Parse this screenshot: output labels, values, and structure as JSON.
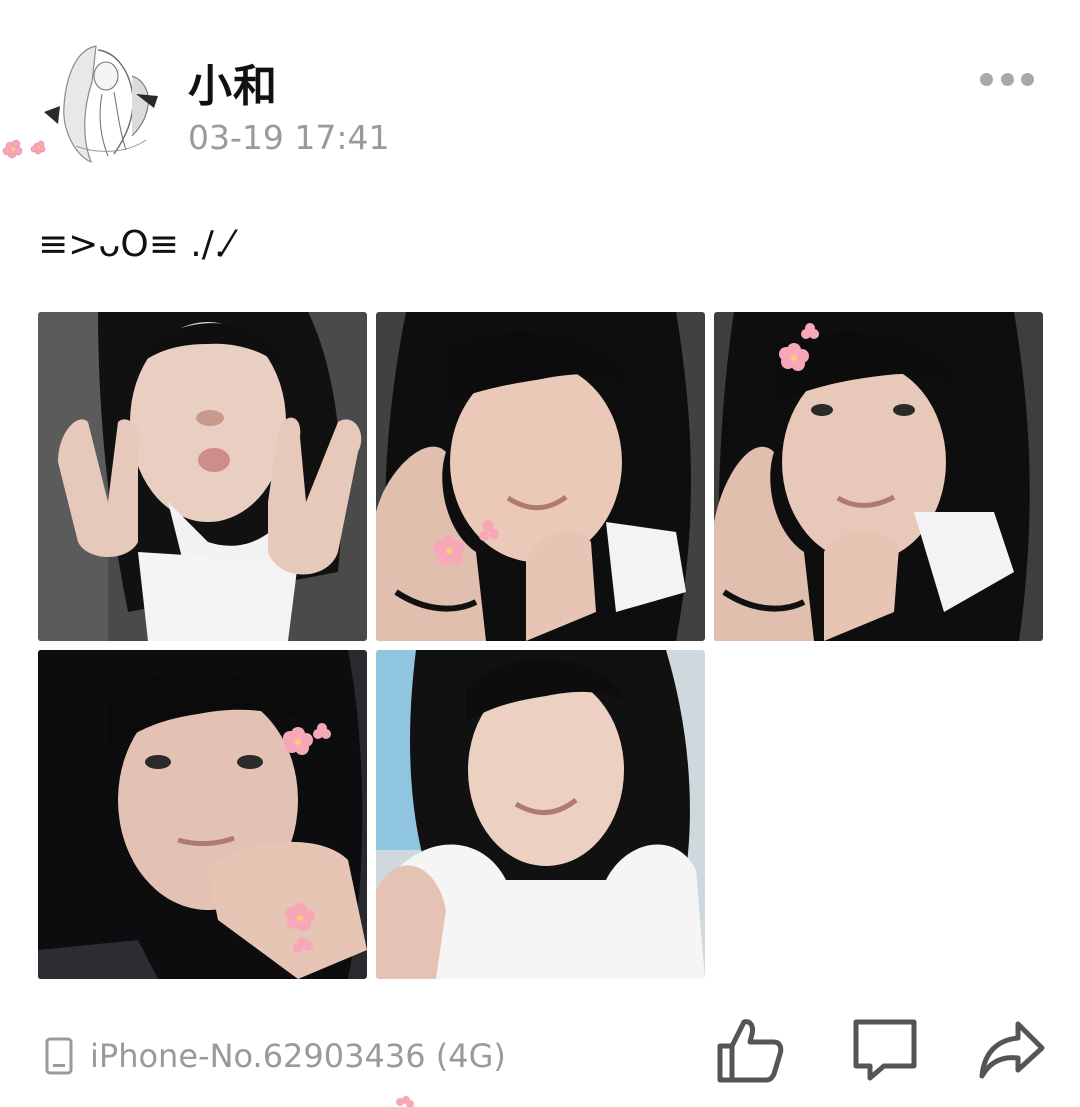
{
  "post": {
    "username": "小和",
    "timestamp": "03-19 17:41",
    "caption": "≡>ᴗO≡ ./.⁄",
    "more_icon": "more-horizontal-icon"
  },
  "photos": [
    {
      "label": "photo-1",
      "subject": "peace-sign-pout"
    },
    {
      "label": "photo-2",
      "subject": "wink-chin-rest"
    },
    {
      "label": "photo-3",
      "subject": "smile-chin-rest"
    },
    {
      "label": "photo-4",
      "subject": "hand-on-chin"
    },
    {
      "label": "photo-5",
      "subject": "wink-smile"
    }
  ],
  "footer": {
    "device_icon": "phone-icon",
    "device": "iPhone-No.62903436 (4G)",
    "actions": {
      "like_icon": "thumbs-up-icon",
      "comment_icon": "comment-icon",
      "share_icon": "share-icon"
    }
  },
  "colors": {
    "text_primary": "#111111",
    "text_secondary": "#9a9a9a",
    "icon_gray": "#555555",
    "background": "#ffffff",
    "sticker_pink": "#f7a8b8"
  }
}
